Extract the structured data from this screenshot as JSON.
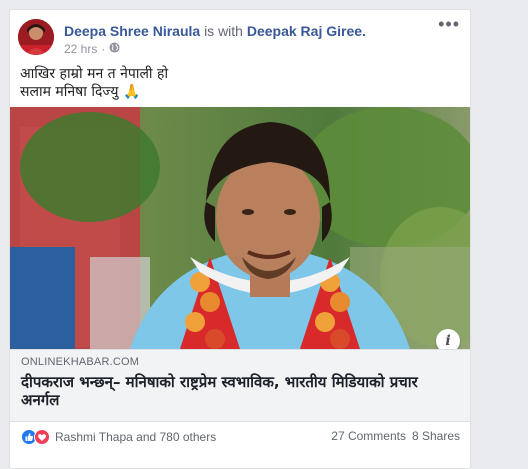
{
  "post": {
    "author": "Deepa Shree Niraula",
    "with_text": "is with",
    "tagged": "Deepak Raj Giree.",
    "time": "22 hrs",
    "audience_icon": "globe-icon",
    "more_icon": "more-options-icon",
    "more_label": "•••",
    "text_line1": "आखिर हाम्रो मन त नेपाली हो",
    "text_line2": "सलाम मनिषा दिज्यु 🙏"
  },
  "link_preview": {
    "domain": "ONLINEKHABAR.COM",
    "headline": "दीपकराज भन्छन्– मनिषाको राष्ट्रप्रेम स्वभाविक, भारतीय मिडियाको प्रचार अनर्गल",
    "info_label": "i"
  },
  "footer": {
    "reactors": "Rashmi Thapa and 780 others",
    "comments": "27 Comments",
    "shares": "8 Shares"
  },
  "colors": {
    "link": "#385898",
    "like": "#2078f4",
    "love": "#f33e58",
    "background": "#e9ebee"
  }
}
